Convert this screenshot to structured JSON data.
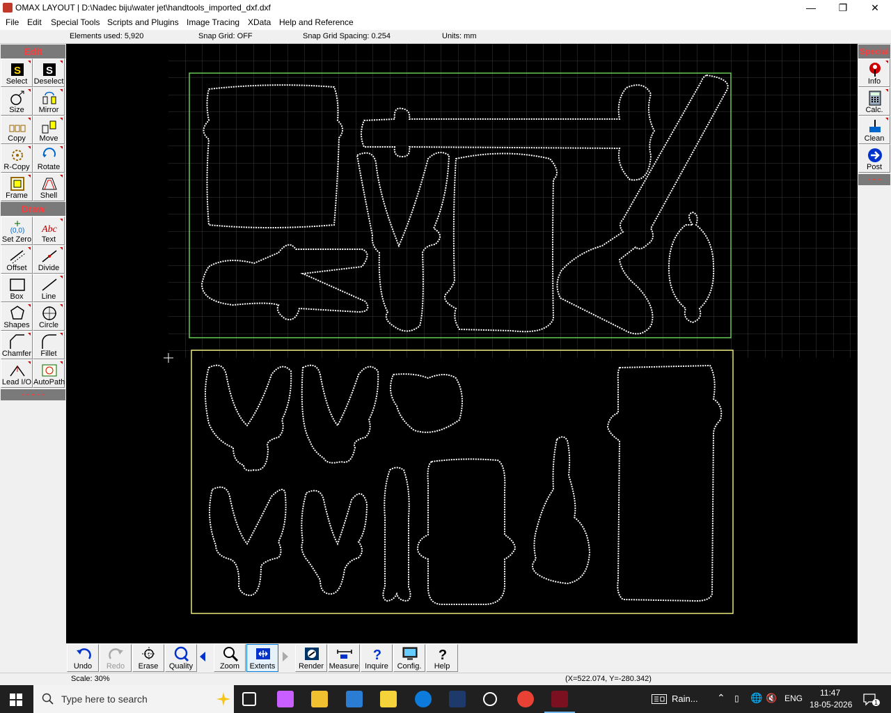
{
  "window": {
    "title": "OMAX LAYOUT | D:\\Nadec biju\\water jet\\handtools_imported_dxf.dxf",
    "minimize": "—",
    "maximize": "❐",
    "close": "✕"
  },
  "menu": [
    "File",
    "Edit",
    "Special Tools",
    "Scripts and Plugins",
    "Image Tracing",
    "XData",
    "Help and Reference"
  ],
  "info": {
    "elements_used": "Elements used: 5,920",
    "snap_grid": "Snap Grid: OFF",
    "snap_spacing": "Snap Grid Spacing: 0.254",
    "units": "Units: mm"
  },
  "left_panel": {
    "edit_title": "Edit",
    "edit_tools": [
      "Select",
      "Deselect",
      "Size",
      "Mirror",
      "Copy",
      "Move",
      "R-Copy",
      "Rotate",
      "Frame",
      "Shell"
    ],
    "draw_title": "Draw",
    "draw_tools": [
      "Set Zero",
      "Text",
      "Offset",
      "Divide",
      "Box",
      "Line",
      "Shapes",
      "Circle",
      "Chamfer",
      "Fillet",
      "Lead I/O",
      "AutoPath"
    ],
    "more": "- - - - -"
  },
  "right_panel": {
    "title": "Special",
    "tools": [
      "Info",
      "Calc.",
      "Clean",
      "Post"
    ],
    "more": "- - -"
  },
  "bottom_tools": [
    "Undo",
    "Redo",
    "Erase",
    "Quality",
    "Zoom",
    "Extents",
    "Render",
    "Measure",
    "Inquire",
    "Config.",
    "Help"
  ],
  "status": {
    "scale": "Scale: 30%",
    "coords": "(X=522.074, Y=-280.342)"
  },
  "taskbar": {
    "search_placeholder": "Type here to search",
    "weather": "Rain...",
    "lang": "ENG",
    "time": "11:47",
    "date": "18-05-2026",
    "notif": "1"
  },
  "colors": {
    "canvas_bg": "#000000",
    "grid": "#3a3a3a",
    "green_frame": "#66cc55",
    "yellow_frame": "#e8e87a",
    "part_outline": "#ffffff",
    "panel_header": "#7a7a7a",
    "panel_header_text": "#ff3b3b"
  }
}
